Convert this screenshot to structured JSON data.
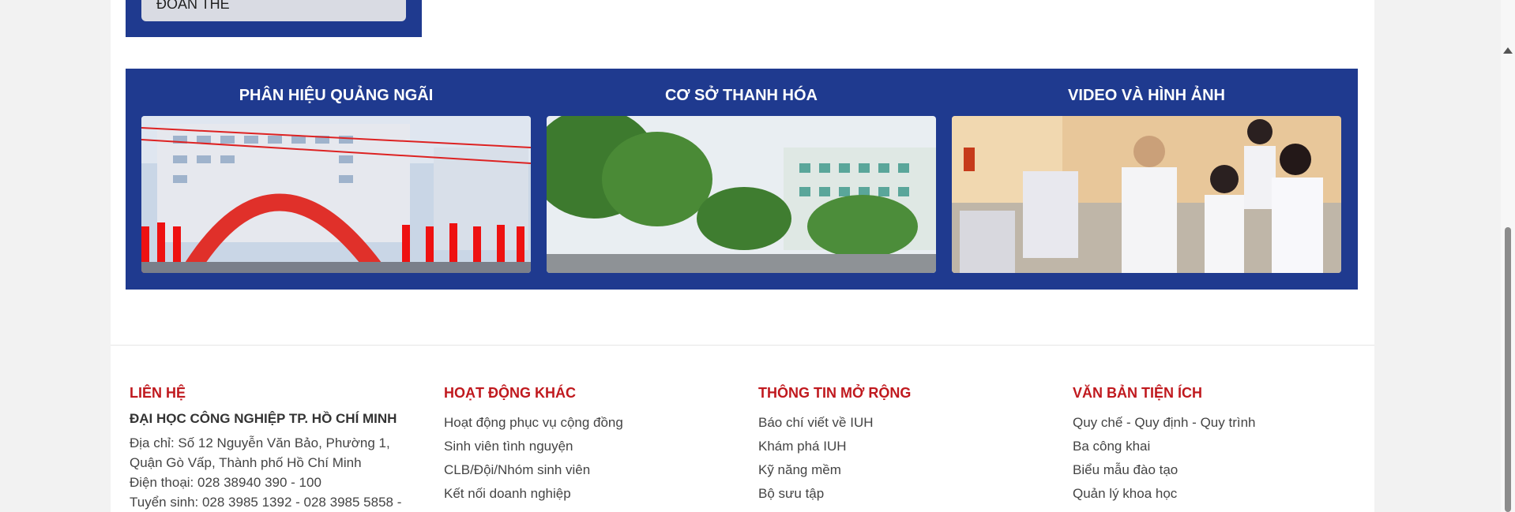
{
  "top_button": {
    "label": "ĐOÀN THỂ"
  },
  "cards": [
    {
      "title": "PHÂN HIỆU QUẢNG NGÃI"
    },
    {
      "title": "CƠ SỞ THANH HÓA"
    },
    {
      "title": "VIDEO VÀ HÌNH ẢNH"
    }
  ],
  "footer": {
    "contact": {
      "heading": "LIÊN HỆ",
      "org": "ĐẠI HỌC CÔNG NGHIỆP TP. HỒ CHÍ MINH",
      "address_line1": "Địa chỉ: Số 12 Nguyễn Văn Bảo, Phường 1,",
      "address_line2": "Quận Gò Vấp, Thành phố Hồ Chí Minh",
      "phone": "Điện thoại: 028 38940 390 - 100",
      "admission": "Tuyển sinh: 028 3985 1392 - 028 3985 5858 -"
    },
    "other": {
      "heading": "HOẠT ĐỘNG KHÁC",
      "links": [
        "Hoạt động phục vụ cộng đồng",
        "Sinh viên tình nguyện",
        "CLB/Đội/Nhóm sinh viên",
        "Kết nối doanh nghiệp"
      ]
    },
    "info": {
      "heading": "THÔNG TIN MỞ RỘNG",
      "links": [
        "Báo chí viết về IUH",
        "Khám phá IUH",
        "Kỹ năng mềm",
        "Bộ sưu tập"
      ]
    },
    "docs": {
      "heading": "VĂN BẢN TIỆN ÍCH",
      "links": [
        "Quy chế - Quy định - Quy trình",
        "Ba công khai",
        "Biểu mẫu đào tạo",
        "Quản lý khoa học"
      ]
    }
  },
  "colors": {
    "brand_blue": "#1f3a8f",
    "heading_red": "#c0191e"
  }
}
